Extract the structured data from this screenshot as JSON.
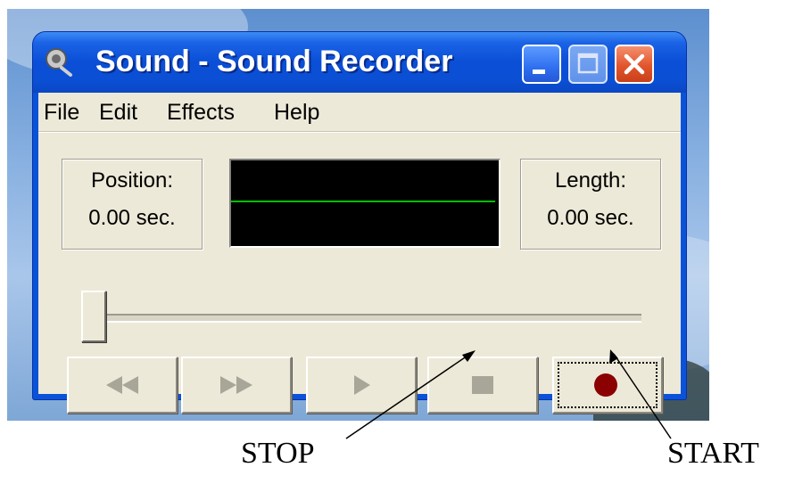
{
  "window": {
    "title": "Sound - Sound Recorder",
    "app_icon": "speaker-icon",
    "controls": [
      "minimize-icon",
      "maximize-icon",
      "close-icon"
    ]
  },
  "menu": {
    "items": [
      "File",
      "Edit",
      "Effects",
      "Help"
    ]
  },
  "position": {
    "label": "Position:",
    "value": "0.00 sec."
  },
  "length": {
    "label": "Length:",
    "value": "0.00 sec."
  },
  "waveform": {
    "background": "#000000",
    "line_color": "#00c000"
  },
  "seek": {
    "position_fraction": 0.0
  },
  "buttons": [
    {
      "name": "seek-to-start-button",
      "icon": "rewind-icon",
      "enabled": false
    },
    {
      "name": "seek-to-end-button",
      "icon": "fast-forward-icon",
      "enabled": false
    },
    {
      "name": "play-button",
      "icon": "play-icon",
      "enabled": false
    },
    {
      "name": "stop-button",
      "icon": "stop-icon",
      "enabled": false
    },
    {
      "name": "record-button",
      "icon": "record-icon",
      "enabled": true,
      "focused": true
    }
  ],
  "annotations": {
    "stop": "STOP",
    "start": "START"
  },
  "colors": {
    "titlebar": "#0a4fd6",
    "close_button": "#e2552c",
    "record_dot": "#8b0000",
    "client": "#ece9d8"
  }
}
